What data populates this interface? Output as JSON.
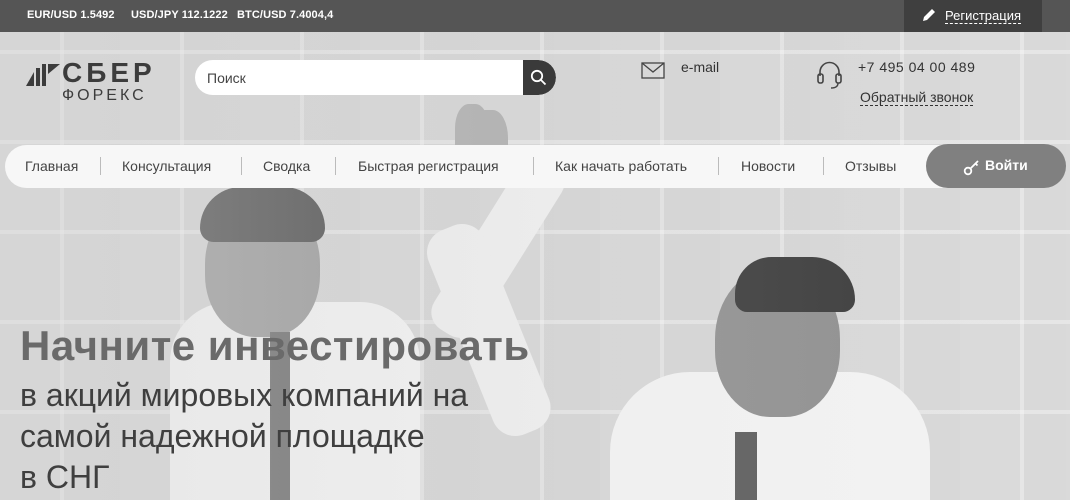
{
  "ticker": {
    "eur": "EUR/USD 1.5492",
    "usd": "USD/JPY 112.1222",
    "btc": "BTC/USD 7.4004,4"
  },
  "topbar": {
    "register_label": "Регистрация"
  },
  "logo": {
    "top": "СБЕР",
    "bottom": "ФОРЕКС"
  },
  "search": {
    "placeholder": "Поиск"
  },
  "contact": {
    "email_label": "e-mail",
    "phone": "+7 495 04 00 489",
    "callback_label": "Обратный звонок"
  },
  "nav": {
    "items": [
      {
        "label": "Главная"
      },
      {
        "label": "Консультация"
      },
      {
        "label": "Сводка"
      },
      {
        "label": "Быстрая регистрация"
      },
      {
        "label": "Как начать работать"
      },
      {
        "label": "Новости"
      },
      {
        "label": "Отзывы"
      }
    ],
    "login_label": "Войти"
  },
  "hero": {
    "title": "Начните инвестировать",
    "line1": "в акций мировых компаний на",
    "line2": "самой надежной площадке",
    "line3": "в СНГ"
  },
  "colors": {
    "topbar": "#555555",
    "accent_dark": "#3a3a3a",
    "login_button": "#808080"
  }
}
